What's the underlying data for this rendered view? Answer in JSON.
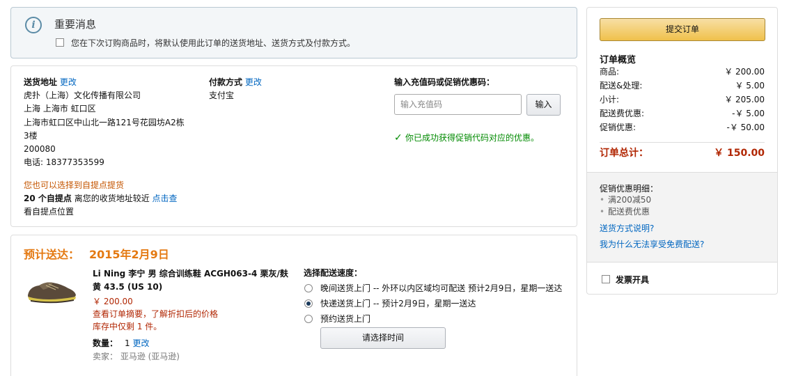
{
  "notice": {
    "icon": "info-icon",
    "title": "重要消息",
    "checkbox_label": "您在下次订购商品时，将默认使用此订单的送货地址、送货方式及付款方式。"
  },
  "shipping": {
    "heading": "送货地址",
    "change": "更改",
    "lines": [
      "虎扑（上海）文化传播有限公司",
      "上海 上海市 虹口区",
      "上海市虹口区中山北一路121号花园坊A2栋",
      "3楼",
      "200080",
      "电话: 18377353599"
    ],
    "pickup_hint": "您也可以选择到自提点提货",
    "pickup_count": "20 个自提点",
    "pickup_text": " 离您的收货地址较近 ",
    "pickup_link": "点击查",
    "pickup_link2": "看自提点位置"
  },
  "payment": {
    "heading": "付款方式",
    "change": "更改",
    "method": "支付宝"
  },
  "promo": {
    "heading": "输入充值码或促销优惠码：",
    "placeholder": "输入充值码",
    "button": "输入",
    "success": "你已成功获得促销代码对应的优惠。"
  },
  "delivery": {
    "eta_label": "预计送达：",
    "eta_date": "2015年2月9日",
    "item": {
      "name": "Li Ning 李宁 男 综合训练鞋 ACGH063-4 栗灰/麸黄 43.5 (US 10)",
      "price": "￥ 200.00",
      "discount_note": "查看订单摘要，了解折扣后的价格",
      "stock": "库存中仅剩 1 件。",
      "qty_label": "数量：",
      "qty": "1",
      "qty_change": "更改",
      "seller": "卖家：  亚马逊 (亚马逊)"
    },
    "speed_heading": "选择配送速度：",
    "options": [
      {
        "label": "晚间送货上门 -- 外环以内区域均可配送 预计2月9日，星期一送达",
        "selected": false
      },
      {
        "label": "快递送货上门 --    预计2月9日，星期一送达",
        "selected": true
      },
      {
        "label": "预约送货上门",
        "selected": false
      }
    ],
    "time_button": "请选择时间"
  },
  "summary": {
    "submit": "提交订单",
    "title": "订单概览",
    "rows": [
      {
        "label": "商品:",
        "value": "￥ 200.00"
      },
      {
        "label": "配送&处理:",
        "value": "￥ 5.00"
      },
      {
        "label": "小计:",
        "value": "￥ 205.00"
      },
      {
        "label": "配送费优惠:",
        "value": "-￥ 5.00"
      },
      {
        "label": "促销优惠:",
        "value": "-￥ 50.00"
      }
    ],
    "total_label": "订单总计：",
    "total_value": "￥ 150.00",
    "promo_title": "促销优惠明细：",
    "promo_items": [
      "满200减50",
      "配送费优惠"
    ],
    "link1": "送货方式说明?",
    "link2": "我为什么无法享受免费配送?",
    "invoice": "发票开具"
  },
  "colors": {
    "accent_orange": "#e47911",
    "price_red": "#b12704",
    "link_blue": "#0066c0",
    "success_green": "#008a00",
    "submit_yellow": "#f0c14b"
  }
}
